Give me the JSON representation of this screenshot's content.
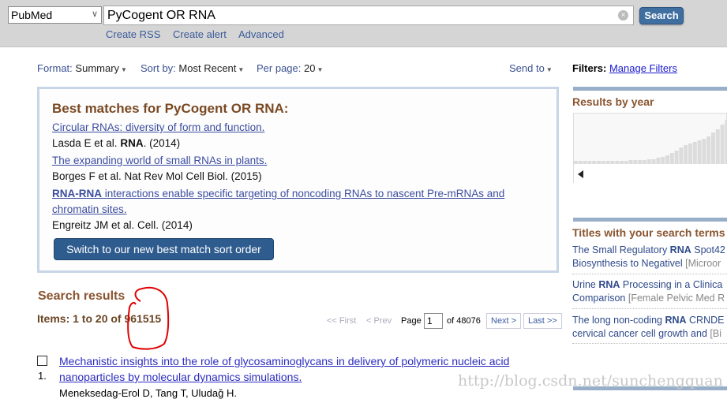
{
  "search": {
    "database": "PubMed",
    "query": "PyCogent OR RNA",
    "button": "Search",
    "links": [
      "Create RSS",
      "Create alert",
      "Advanced"
    ]
  },
  "toolbar": {
    "format_label": "Format:",
    "format_value": "Summary",
    "sort_label": "Sort by:",
    "sort_value": "Most Recent",
    "perpage_label": "Per page:",
    "perpage_value": "20",
    "send_to": "Send to",
    "filters_label": "Filters:",
    "manage_filters": "Manage Filters"
  },
  "best_matches": {
    "title": "Best matches for PyCogent OR RNA:",
    "items": [
      {
        "title": "Circular RNAs: diversity of form and function.",
        "authors": "Lasda E et al.",
        "journal": "RNA",
        "year": ". (2014)"
      },
      {
        "title": "The expanding world of small RNAs in plants.",
        "authors": "Borges F et al. Nat Rev Mol Cell Biol. (2015)"
      },
      {
        "title_bold": "RNA-RNA",
        "title_line1": " interactions enable specific targeting of noncoding RNAs to nascent Pre-mRNAs and",
        "title_line2": "chromatin sites.",
        "authors": "Engreitz JM et al. Cell. (2014)"
      }
    ],
    "button": "Switch to our new best match sort order"
  },
  "results": {
    "heading": "Search results",
    "items_label": "Items: 1 to 20 of ",
    "total": "961515",
    "pager": {
      "first": "<< First",
      "prev": "< Prev",
      "page_label": "Page",
      "page": "1",
      "of": "of 48076",
      "next": "Next >",
      "last": "Last >>"
    },
    "list": [
      {
        "num": "1.",
        "title_line1": "Mechanistic insights into the role of glycosaminoglycans in delivery of polymeric nucleic acid",
        "title_line2": "nanoparticles by molecular dynamics simulations.",
        "authors": "Meneksedag-Erol D, Tang T, Uludağ H."
      }
    ]
  },
  "sidebar": {
    "results_by_year": "Results by year",
    "year_bars": [
      4,
      4,
      4,
      4,
      4,
      4,
      4,
      4,
      4,
      4,
      4,
      4,
      5,
      5,
      5,
      5,
      6,
      6,
      8,
      9,
      11,
      14,
      17,
      21,
      24,
      26,
      28,
      30,
      32,
      35,
      40,
      44,
      50,
      56
    ],
    "titles_heading": "Titles with your search terms",
    "titles": [
      {
        "pre": "The Small Regulatory ",
        "bold": "RNA",
        "post": " Spot42",
        "line2": "Biosynthesis to Negativel ",
        "journal": "[Microor"
      },
      {
        "pre": "Urine ",
        "bold": "RNA",
        "post": " Processing in a Clinica",
        "line2": "Comparison  ",
        "journal": "[Female Pelvic Med R"
      },
      {
        "pre": "The long non-coding ",
        "bold": "RNA",
        "post": " CRNDE",
        "line2": "cervical cancer cell growth and ",
        "journal": "[Bi"
      }
    ]
  },
  "watermark": "http://blog.csdn.net/sunchengquan",
  "colors": {
    "accent": "#3f6fa0",
    "heading": "#8a5530",
    "annotation": "#e00000"
  }
}
